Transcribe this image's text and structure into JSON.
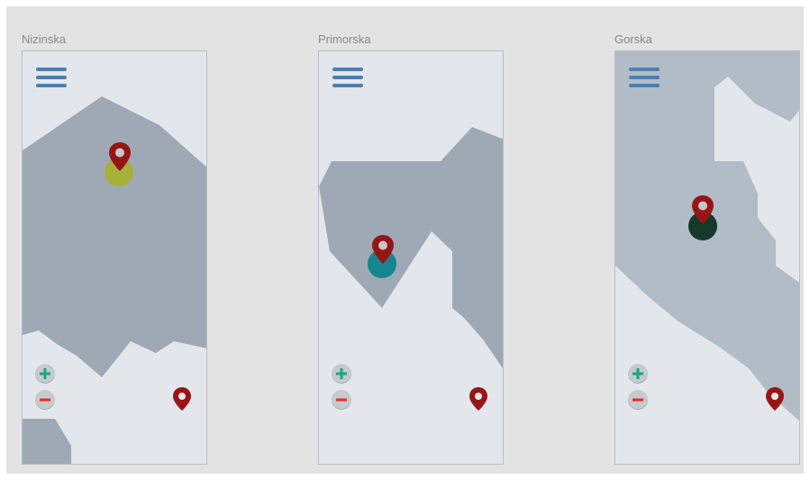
{
  "panels": [
    {
      "title": "Nizinska",
      "marker_color": "#a6b13a",
      "pin_color": "#961616",
      "zoom_in_icon": "plus-icon",
      "zoom_out_icon": "minus-icon",
      "menu_icon": "hamburger-menu-icon",
      "locate_icon": "location-pin-icon"
    },
    {
      "title": "Primorska",
      "marker_color": "#14868f",
      "pin_color": "#961616",
      "zoom_in_icon": "plus-icon",
      "zoom_out_icon": "minus-icon",
      "menu_icon": "hamburger-menu-icon",
      "locate_icon": "location-pin-icon"
    },
    {
      "title": "Gorska",
      "marker_color": "#17392a",
      "pin_color": "#961616",
      "zoom_in_icon": "plus-icon",
      "zoom_out_icon": "minus-icon",
      "menu_icon": "hamburger-menu-icon",
      "locate_icon": "location-pin-icon"
    }
  ],
  "colors": {
    "background": "#e3e3e3",
    "land": "#e3e7ec",
    "region_dark": "#9fa9b5",
    "region_light": "#b2bcc6",
    "menu": "#4f7fae",
    "zoom_in": "#1aa57c",
    "zoom_out": "#e0302a",
    "pin": "#961616"
  }
}
